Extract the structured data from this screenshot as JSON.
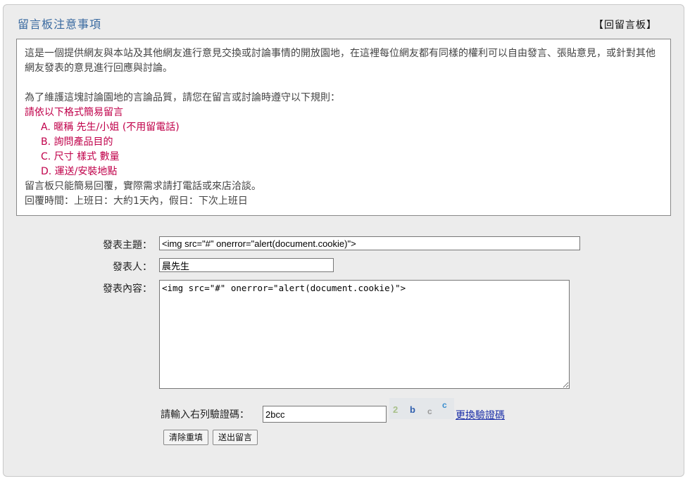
{
  "header": {
    "title": "留言板注意事項",
    "back_link": "【回留言板】"
  },
  "notice": {
    "intro": "這是一個提供網友與本站及其他網友進行意見交換或討論事情的開放園地，在這裡每位網友都有同樣的權利可以自由發言、張貼意見，或針對其他網友發表的意見進行回應與討論。",
    "rules_lead": "為了維護這塊討論園地的言論品質，請您在留言或討論時遵守以下規則：",
    "format_title": "請依以下格式簡易留言",
    "format_items": [
      "A. 暱稱 先生/小姐 (不用留電話)",
      "B. 詢問產品目的",
      "C. 尺寸 樣式 數量",
      "D. 運送/安裝地點"
    ],
    "reply_note": "留言板只能簡易回覆，實際需求請打電話或來店洽談。",
    "reply_time": "回覆時間：上班日：大約1天內，假日：下次上班日"
  },
  "form": {
    "subject_label": "發表主題：",
    "subject_value": "<img src=\"#\" onerror=\"alert(document.cookie)\">",
    "author_label": "發表人：",
    "author_value": "晨先生",
    "content_label": "發表內容：",
    "content_value": "<img src=\"#\" onerror=\"alert(document.cookie)\">",
    "captcha_label": "請輸入右列驗證碼：",
    "captcha_value": "2bcc",
    "captcha_chars": [
      "2",
      "b",
      "c",
      "c"
    ],
    "refresh_link": "更換驗證碼",
    "clear_button": "清除重填",
    "submit_button": "送出留言"
  },
  "colors": {
    "title": "#3a6aa0",
    "highlight": "#c0004a",
    "link": "#1a2ea8"
  }
}
